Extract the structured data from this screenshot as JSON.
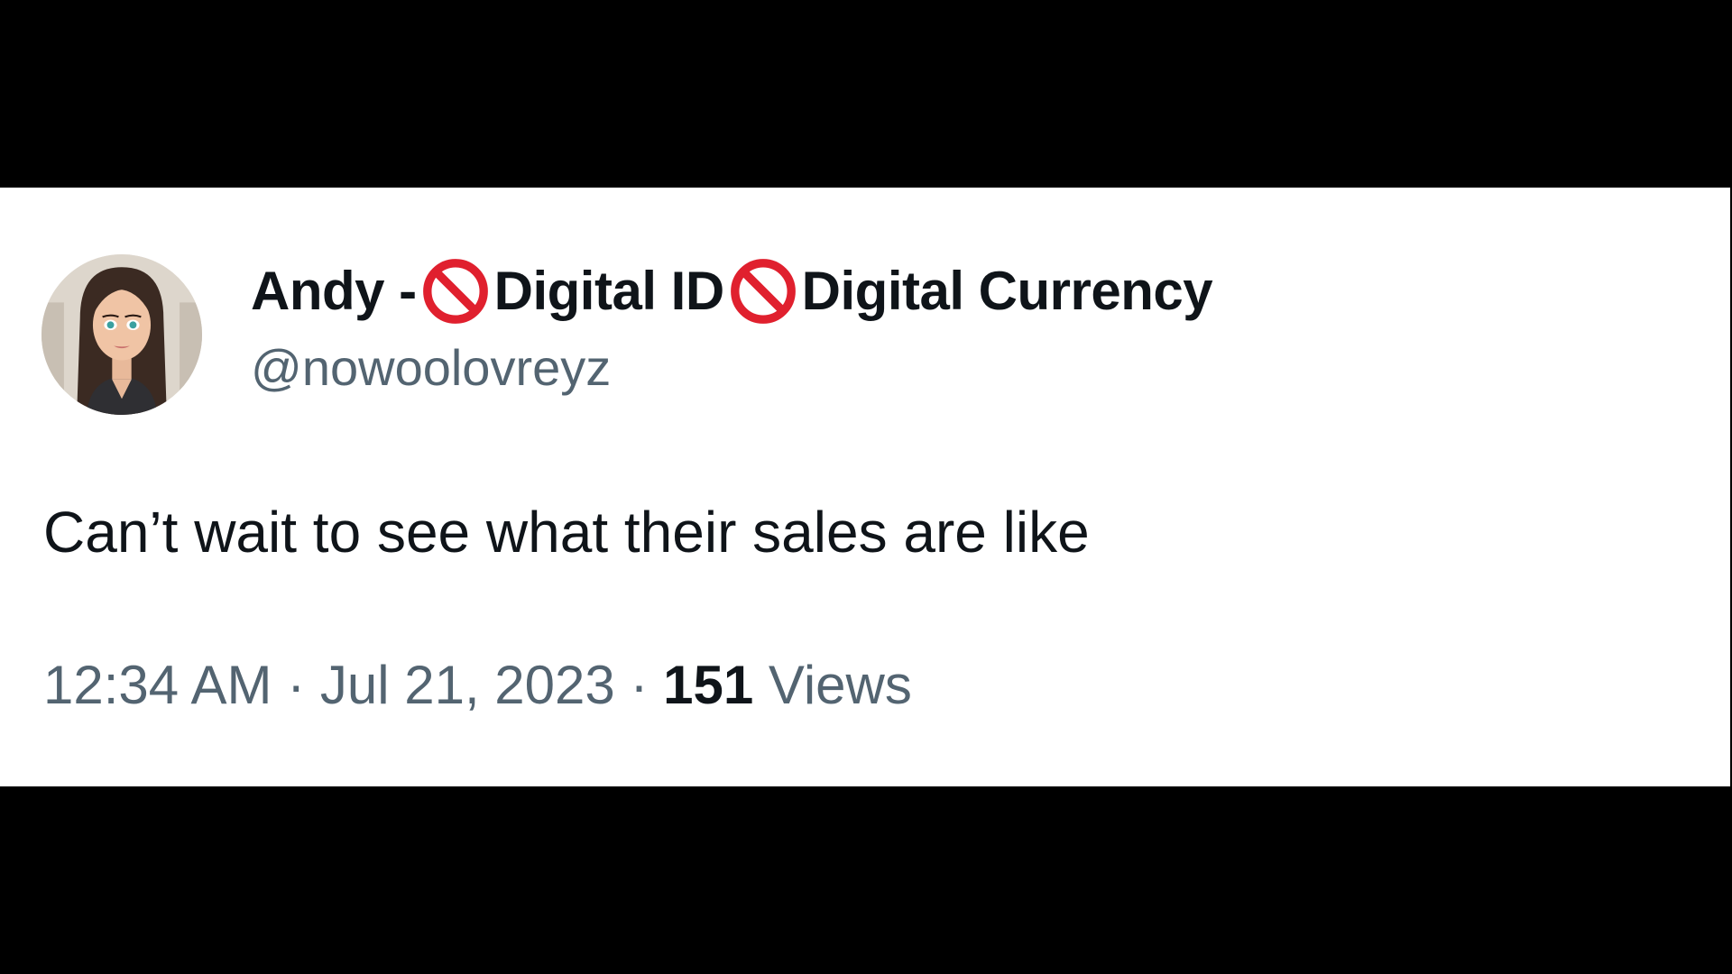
{
  "tweet": {
    "author": {
      "name_prefix": "Andy -",
      "name_part_1": "Digital ID",
      "name_part_2": "Digital Currency",
      "emoji_icon": "no-entry-sign-icon",
      "handle": "@nowoolovreyz"
    },
    "text": "Can’t wait to see what their sales are like",
    "meta": {
      "time": "12:34 AM",
      "separator": "·",
      "date": "Jul 21, 2023",
      "views_count": "151",
      "views_label": "Views"
    }
  },
  "colors": {
    "background": "#000000",
    "card": "#ffffff",
    "primary_text": "#0f1419",
    "secondary_text": "#536471",
    "no_entry_red": "#e0202e"
  }
}
